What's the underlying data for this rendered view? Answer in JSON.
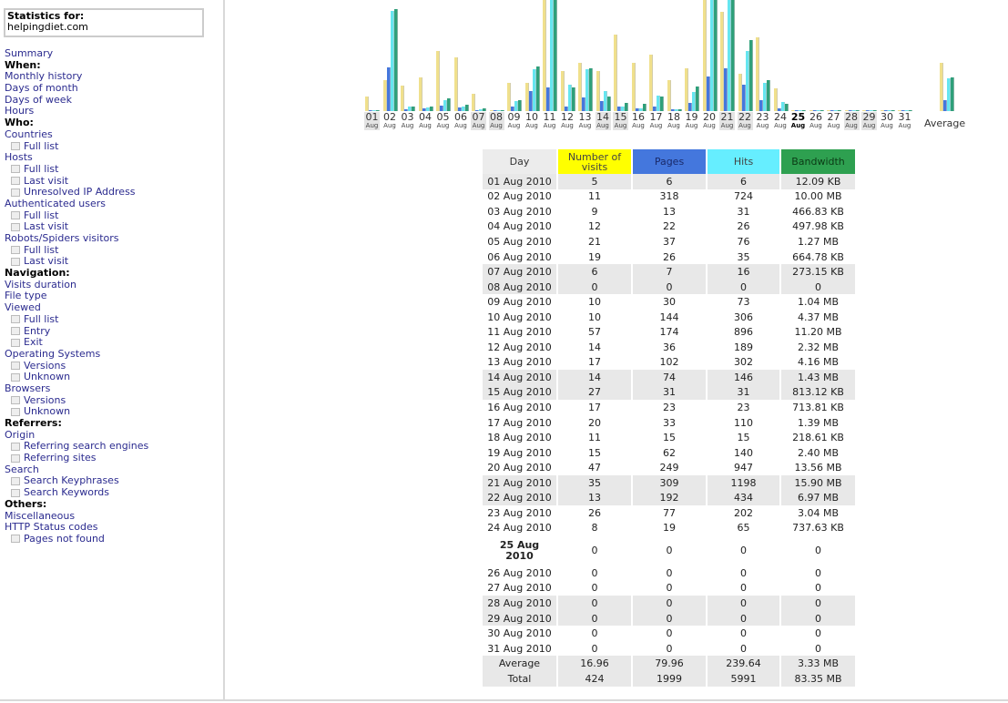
{
  "sidebar": {
    "stats_for_label": "Statistics for:",
    "site": "helpingdiet.com",
    "items": [
      {
        "t": "Summary",
        "k": "lnk"
      },
      {
        "t": "When:",
        "k": "hd"
      },
      {
        "t": "Monthly history",
        "k": "lnk"
      },
      {
        "t": "Days of month",
        "k": "lnk"
      },
      {
        "t": "Days of week",
        "k": "lnk"
      },
      {
        "t": "Hours",
        "k": "lnk"
      },
      {
        "t": "Who:",
        "k": "hd"
      },
      {
        "t": "Countries",
        "k": "lnk"
      },
      {
        "t": "Full list",
        "k": "sub"
      },
      {
        "t": "Hosts",
        "k": "lnk"
      },
      {
        "t": "Full list",
        "k": "sub"
      },
      {
        "t": "Last visit",
        "k": "sub"
      },
      {
        "t": "Unresolved IP Address",
        "k": "sub"
      },
      {
        "t": "Authenticated users",
        "k": "lnk"
      },
      {
        "t": "Full list",
        "k": "sub"
      },
      {
        "t": "Last visit",
        "k": "sub"
      },
      {
        "t": "Robots/Spiders visitors",
        "k": "lnk"
      },
      {
        "t": "Full list",
        "k": "sub"
      },
      {
        "t": "Last visit",
        "k": "sub"
      },
      {
        "t": "Navigation:",
        "k": "hd"
      },
      {
        "t": "Visits duration",
        "k": "lnk"
      },
      {
        "t": "File type",
        "k": "lnk"
      },
      {
        "t": "Viewed",
        "k": "lnk"
      },
      {
        "t": "Full list",
        "k": "sub"
      },
      {
        "t": "Entry",
        "k": "sub"
      },
      {
        "t": "Exit",
        "k": "sub"
      },
      {
        "t": "Operating Systems",
        "k": "lnk"
      },
      {
        "t": "Versions",
        "k": "sub"
      },
      {
        "t": "Unknown",
        "k": "sub"
      },
      {
        "t": "Browsers",
        "k": "lnk"
      },
      {
        "t": "Versions",
        "k": "sub"
      },
      {
        "t": "Unknown",
        "k": "sub"
      },
      {
        "t": "Referrers:",
        "k": "hd"
      },
      {
        "t": "Origin",
        "k": "lnk"
      },
      {
        "t": "Referring search engines",
        "k": "sub"
      },
      {
        "t": "Referring sites",
        "k": "sub"
      },
      {
        "t": "Search",
        "k": "lnk"
      },
      {
        "t": "Search Keyphrases",
        "k": "sub"
      },
      {
        "t": "Search Keywords",
        "k": "sub"
      },
      {
        "t": "Others:",
        "k": "hd"
      },
      {
        "t": "Miscellaneous",
        "k": "lnk"
      },
      {
        "t": "HTTP Status codes",
        "k": "lnk"
      },
      {
        "t": "Pages not found",
        "k": "sub"
      }
    ]
  },
  "colors": {
    "visits": "#f0e08c",
    "pages": "#4477dd",
    "hits": "#66e6f0",
    "bandwidth": "#2ea07a",
    "hdr_visits": "#ffff00",
    "hdr_pages": "#4477dd",
    "hdr_hits": "#66eeff",
    "hdr_bandwidth": "#2ea050"
  },
  "table": {
    "headers": [
      "Day",
      "Number of visits",
      "Pages",
      "Hits",
      "Bandwidth"
    ],
    "rows": [
      [
        "01 Aug 2010",
        "5",
        "6",
        "6",
        "12.09 KB"
      ],
      [
        "02 Aug 2010",
        "11",
        "318",
        "724",
        "10.00 MB"
      ],
      [
        "03 Aug 2010",
        "9",
        "13",
        "31",
        "466.83 KB"
      ],
      [
        "04 Aug 2010",
        "12",
        "22",
        "26",
        "497.98 KB"
      ],
      [
        "05 Aug 2010",
        "21",
        "37",
        "76",
        "1.27 MB"
      ],
      [
        "06 Aug 2010",
        "19",
        "26",
        "35",
        "664.78 KB"
      ],
      [
        "07 Aug 2010",
        "6",
        "7",
        "16",
        "273.15 KB"
      ],
      [
        "08 Aug 2010",
        "0",
        "0",
        "0",
        "0"
      ],
      [
        "09 Aug 2010",
        "10",
        "30",
        "73",
        "1.04 MB"
      ],
      [
        "10 Aug 2010",
        "10",
        "144",
        "306",
        "4.37 MB"
      ],
      [
        "11 Aug 2010",
        "57",
        "174",
        "896",
        "11.20 MB"
      ],
      [
        "12 Aug 2010",
        "14",
        "36",
        "189",
        "2.32 MB"
      ],
      [
        "13 Aug 2010",
        "17",
        "102",
        "302",
        "4.16 MB"
      ],
      [
        "14 Aug 2010",
        "14",
        "74",
        "146",
        "1.43 MB"
      ],
      [
        "15 Aug 2010",
        "27",
        "31",
        "31",
        "813.12 KB"
      ],
      [
        "16 Aug 2010",
        "17",
        "23",
        "23",
        "713.81 KB"
      ],
      [
        "17 Aug 2010",
        "20",
        "33",
        "110",
        "1.39 MB"
      ],
      [
        "18 Aug 2010",
        "11",
        "15",
        "15",
        "218.61 KB"
      ],
      [
        "19 Aug 2010",
        "15",
        "62",
        "140",
        "2.40 MB"
      ],
      [
        "20 Aug 2010",
        "47",
        "249",
        "947",
        "13.56 MB"
      ],
      [
        "21 Aug 2010",
        "35",
        "309",
        "1198",
        "15.90 MB"
      ],
      [
        "22 Aug 2010",
        "13",
        "192",
        "434",
        "6.97 MB"
      ],
      [
        "23 Aug 2010",
        "26",
        "77",
        "202",
        "3.04 MB"
      ],
      [
        "24 Aug 2010",
        "8",
        "19",
        "65",
        "737.63 KB"
      ],
      [
        "25 Aug 2010",
        "0",
        "0",
        "0",
        "0"
      ],
      [
        "26 Aug 2010",
        "0",
        "0",
        "0",
        "0"
      ],
      [
        "27 Aug 2010",
        "0",
        "0",
        "0",
        "0"
      ],
      [
        "28 Aug 2010",
        "0",
        "0",
        "0",
        "0"
      ],
      [
        "29 Aug 2010",
        "0",
        "0",
        "0",
        "0"
      ],
      [
        "30 Aug 2010",
        "0",
        "0",
        "0",
        "0"
      ],
      [
        "31 Aug 2010",
        "0",
        "0",
        "0",
        "0"
      ]
    ],
    "average": [
      "Average",
      "16.96",
      "79.96",
      "239.64",
      "3.33 MB"
    ],
    "total": [
      "Total",
      "424",
      "1999",
      "5991",
      "83.35 MB"
    ]
  },
  "chart": {
    "month": "Aug",
    "days": [
      "01",
      "02",
      "03",
      "04",
      "05",
      "06",
      "07",
      "08",
      "09",
      "10",
      "11",
      "12",
      "13",
      "14",
      "15",
      "16",
      "17",
      "18",
      "19",
      "20",
      "21",
      "22",
      "23",
      "24",
      "25",
      "26",
      "27",
      "28",
      "29",
      "30",
      "31"
    ],
    "weekend_days": [
      1,
      7,
      8,
      14,
      15,
      21,
      22,
      28,
      29
    ],
    "current_day": 25,
    "average_label": "Average",
    "bandwidth_mb": [
      0.0118,
      10.0,
      0.456,
      0.486,
      1.27,
      0.649,
      0.267,
      0,
      1.04,
      4.37,
      11.2,
      2.32,
      4.16,
      1.43,
      0.794,
      0.697,
      1.39,
      0.213,
      2.4,
      13.56,
      15.9,
      6.97,
      3.04,
      0.72,
      0,
      0,
      0,
      0,
      0,
      0,
      0
    ],
    "average_bandwidth_mb": 3.33
  }
}
